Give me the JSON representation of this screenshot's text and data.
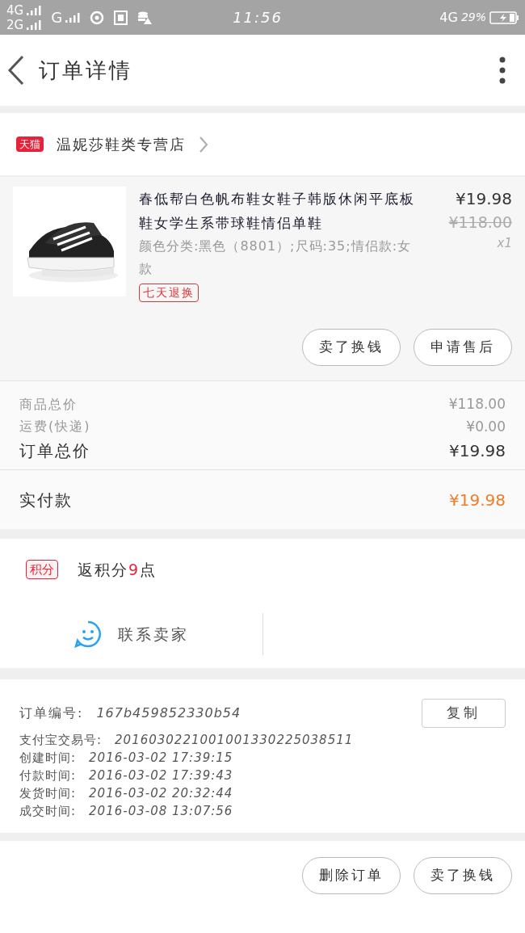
{
  "status_bar": {
    "network_1": "4G",
    "network_2": "2G",
    "network_3": "G",
    "time": "11:56",
    "network_4": "4G",
    "battery": "29%"
  },
  "header": {
    "title": "订单详情"
  },
  "store": {
    "badge": "天猫",
    "name": "温妮莎鞋类专营店"
  },
  "product": {
    "title": "春低帮白色帆布鞋女鞋子韩版休闲平底板鞋女学生系带球鞋情侣单鞋",
    "specs": "颜色分类:黑色（8801）;尺码:35;情侣款:女款",
    "tag": "七天退换",
    "price": "¥19.98",
    "original_price": "¥118.00",
    "quantity": "x1",
    "actions": [
      "卖了换钱",
      "申请售后"
    ]
  },
  "summary": [
    {
      "label": "商品总价",
      "value": "¥118.00",
      "kind": "minor"
    },
    {
      "label": "运费(快递)",
      "value": "¥0.00",
      "kind": "minor"
    },
    {
      "label": "订单总价",
      "value": "¥19.98",
      "kind": "major"
    }
  ],
  "paid": {
    "label": "实付款",
    "value": "¥19.98"
  },
  "points": {
    "badge": "积分",
    "prefix": "返积分",
    "count": "9",
    "suffix": "点"
  },
  "contact": {
    "label": "联系卖家"
  },
  "order_info": {
    "number_label": "订单编号:",
    "number": "167b459852330b54",
    "copy": "复制",
    "rows": [
      {
        "label": "支付宝交易号:",
        "value": "2016030221001001330225038511"
      },
      {
        "label": "创建时间:",
        "value": "2016-03-02 17:39:15"
      },
      {
        "label": "付款时间:",
        "value": "2016-03-02 17:39:43"
      },
      {
        "label": "发货时间:",
        "value": "2016-03-02 20:32:44"
      },
      {
        "label": "成交时间:",
        "value": "2016-03-08 13:07:56"
      }
    ]
  },
  "bottom_actions": [
    "删除订单",
    "卖了换钱"
  ]
}
